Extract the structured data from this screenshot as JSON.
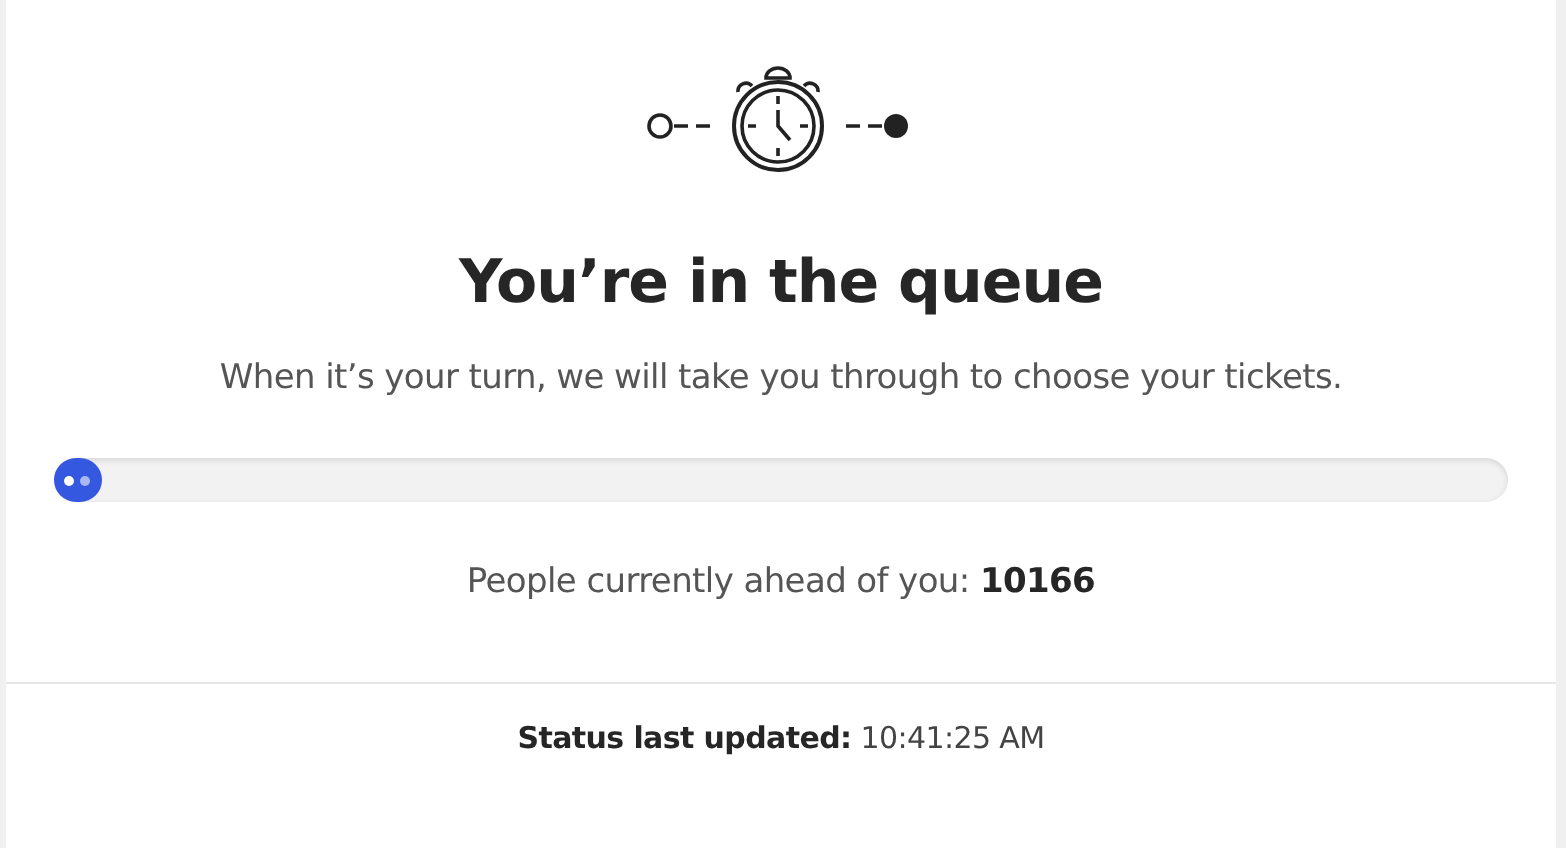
{
  "title": "You’re in the queue",
  "subtitle": "When it’s your turn, we will take you through to choose your tickets.",
  "ahead": {
    "label": "People currently ahead of you:",
    "count": "10166"
  },
  "status": {
    "label": "Status last updated:",
    "time": "10:41:25 AM"
  }
}
